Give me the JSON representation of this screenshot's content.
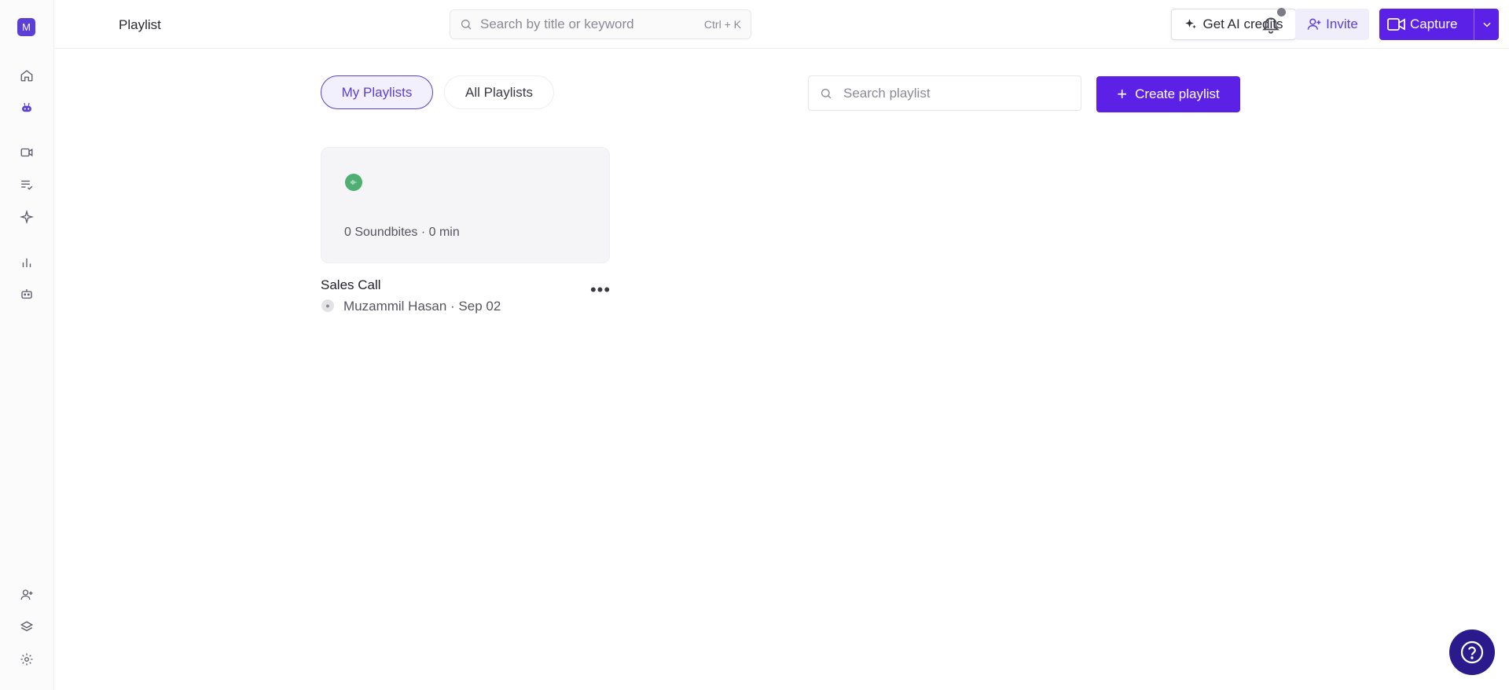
{
  "sidebar": {
    "workspace_initial": "M",
    "icons": [
      "home-icon",
      "bot-icon",
      "video-icon",
      "list-check-icon",
      "sparkle-icon",
      "bar-chart-icon",
      "robot-icon",
      "add-user-icon",
      "layers-icon",
      "gear-icon"
    ]
  },
  "header": {
    "title": "Playlist",
    "search_placeholder": "Search by title or keyword",
    "search_shortcut": "Ctrl + K",
    "ai_credits_label": "Get AI credits",
    "invite_label": "Invite",
    "capture_label": "Capture"
  },
  "tabs": [
    {
      "label": "My Playlists",
      "active": true
    },
    {
      "label": "All Playlists",
      "active": false
    }
  ],
  "playlist_search_placeholder": "Search playlist",
  "create_button_label": "Create playlist",
  "playlists": [
    {
      "stats": "0 Soundbites · 0 min",
      "name": "Sales Call",
      "owner_meta": "Muzammil Hasan · Sep 02"
    }
  ],
  "colors": {
    "accent": "#5b21e6",
    "accent_soft": "#f3f0fd",
    "help_bg": "#2a1a8c",
    "badge_green": "#4fae72"
  }
}
